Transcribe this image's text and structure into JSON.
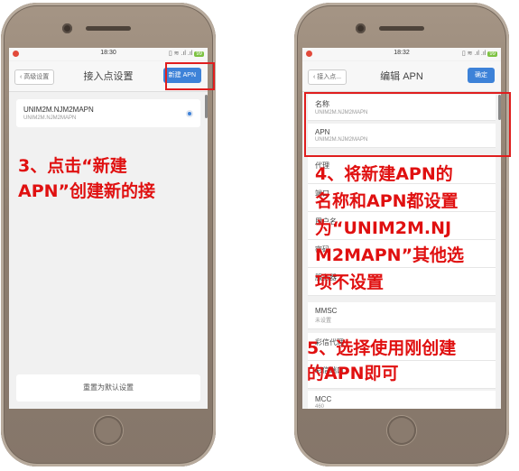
{
  "left_phone": {
    "status_time": "18:30",
    "battery": "99",
    "back_label": "高级设置",
    "title": "接入点设置",
    "action_label": "新建 APN",
    "apn_name": "UNIM2M.NJM2MAPN",
    "apn_sub": "UNIM2M.NJM2MAPN",
    "reset_label": "重置为默认设置"
  },
  "right_phone": {
    "status_time": "18:32",
    "battery": "99",
    "back_label": "接入点...",
    "title": "编辑 APN",
    "action_label": "确定",
    "fields": [
      {
        "label": "名称",
        "value": "UNIM2M.NJM2MAPN"
      },
      {
        "label": "APN",
        "value": "UNIM2M.NJM2MAPN"
      },
      {
        "label": "代理",
        "value": ""
      },
      {
        "label": "端口",
        "value": ""
      },
      {
        "label": "用户名",
        "value": ""
      },
      {
        "label": "密码",
        "value": ""
      },
      {
        "label": "服务器",
        "value": ""
      },
      {
        "label": "MMSC",
        "value": "未设置"
      },
      {
        "label": "彩信代理",
        "value": ""
      },
      {
        "label": "彩信端口",
        "value": ""
      },
      {
        "label": "MCC",
        "value": "460"
      }
    ]
  },
  "annotations": {
    "step3_line1": "3、点击“新建",
    "step3_line2": "APN”创建新的接",
    "step4_line1": "4、将新建APN的",
    "step4_line2": "名称和APN都设置",
    "step4_line3": "为“UNIM2M.NJ",
    "step4_line4": "M2MAPN”其他选",
    "step4_line5": "项不设置",
    "step5_line1": "5、选择使用刚创建",
    "step5_line2": "的APN即可"
  },
  "colors": {
    "annotation_red": "#e01010",
    "accent_blue": "#3d82d8",
    "phone_body": "#8e7e6f"
  }
}
